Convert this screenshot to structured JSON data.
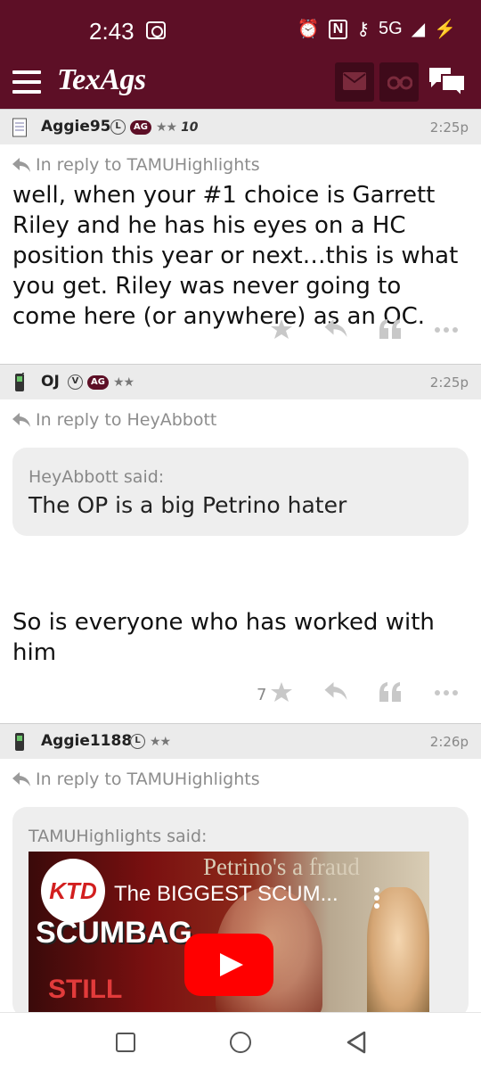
{
  "status_bar": {
    "time": "2:43",
    "network": "5G"
  },
  "app": {
    "brand": "TexAgs",
    "icons": [
      "menu-icon",
      "mail-icon",
      "binoculars-icon",
      "chat-icon"
    ]
  },
  "posts": [
    {
      "username": "Aggie95",
      "badges": [
        "L",
        "AG"
      ],
      "stars": "★★",
      "rank_badge": "10",
      "time": "2:25p",
      "reply_to": "In reply to TAMUHighlights",
      "body": "well, when your #1 choice is Garrett Riley and he has his eyes on a HC position this year or next…this is what you get. Riley was never going to come here (or anywhere) as an OC.",
      "star_count": ""
    },
    {
      "username": "OJ",
      "badges": [
        "V",
        "AG"
      ],
      "stars": "★★",
      "time": "2:25p",
      "reply_to": "In reply to HeyAbbott",
      "quote_author": "HeyAbbott said:",
      "quote_text": "The OP is a big Petrino hater",
      "body": "So is everyone who has worked with him",
      "star_count": "7"
    },
    {
      "username": "Aggie1188",
      "badges": [
        "L"
      ],
      "stars": "★★",
      "time": "2:26p",
      "reply_to": "In reply to TAMUHighlights",
      "quote_author": "TAMUHighlights said:",
      "video": {
        "channel_logo": "KTD",
        "title": "The BIGGEST SCUM...",
        "overlay_text": "Petrino's a fraud",
        "thumbnail_text_1": "SCUMBAG",
        "thumbnail_text_2": "STILL"
      }
    }
  ],
  "colors": {
    "brand": "#5d0f26",
    "header_bg": "#ebebeb",
    "quote_bg": "#eeeeee"
  }
}
